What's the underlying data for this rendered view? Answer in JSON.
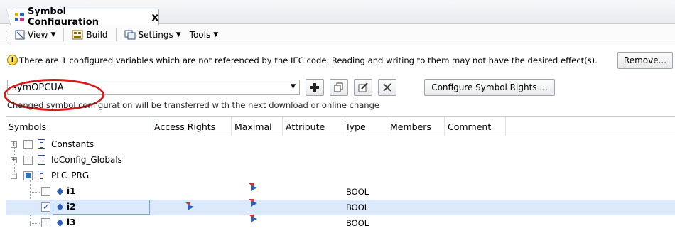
{
  "tab": {
    "title": "Symbol Configuration",
    "close": "x"
  },
  "toolbar": {
    "view_label": "View",
    "build_label": "Build",
    "settings_label": "Settings",
    "tools_label": "Tools"
  },
  "warning": {
    "text": "There are 1 configured variables which are not referenced by the IEC code. Reading and writing to them may not have the desired effect(s).",
    "remove_label": "Remove..."
  },
  "config": {
    "selected": "symOPCUA",
    "rights_label": "Configure Symbol Rights ...",
    "info": "Changed symbol configuration will be transferred with the next download or online change"
  },
  "tree": {
    "columns": [
      "Symbols",
      "Access Rights",
      "Maximal",
      "Attribute",
      "Type",
      "Members",
      "Comment"
    ],
    "rows": [
      {
        "name": "Constants",
        "type": ""
      },
      {
        "name": "IoConfig_Globals",
        "type": ""
      },
      {
        "name": "PLC_PRG",
        "type": ""
      },
      {
        "name": "i1",
        "type": "BOOL"
      },
      {
        "name": "i2",
        "type": "BOOL"
      },
      {
        "name": "i3",
        "type": "BOOL"
      }
    ]
  },
  "colors": {
    "highlight": "#d71a1a",
    "selection": "#dbe9fb",
    "accent": "#2c6fcb"
  }
}
